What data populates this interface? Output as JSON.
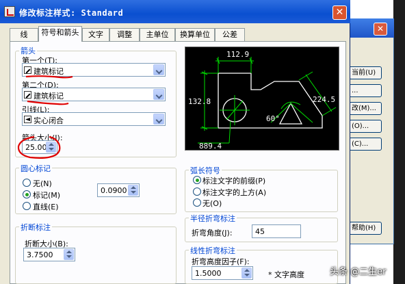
{
  "window": {
    "title": "修改标注样式: Standard",
    "close_glyph": "✕"
  },
  "tabs": [
    {
      "label": "线"
    },
    {
      "label": "符号和箭头"
    },
    {
      "label": "文字"
    },
    {
      "label": "调整"
    },
    {
      "label": "主单位"
    },
    {
      "label": "换算单位"
    },
    {
      "label": "公差"
    }
  ],
  "arrowheads": {
    "group_title": "箭头",
    "first_label": "第一个(T):",
    "first_value": "建筑标记",
    "second_label": "第二个(D):",
    "second_value": "建筑标记",
    "leader_label": "引线(L):",
    "leader_value": "实心闭合",
    "size_label": "箭头大小(I):",
    "size_value": "25.000("
  },
  "center_marks": {
    "group_title": "圆心标记",
    "options": [
      "无(N)",
      "标记(M)",
      "直线(E)"
    ],
    "selected": "标记(M)",
    "size_value": "0.0900"
  },
  "break": {
    "group_title": "折断标注",
    "size_label": "折断大小(B):",
    "size_value": "3.7500"
  },
  "arc_length": {
    "group_title": "弧长符号",
    "options": [
      "标注文字的前缀(P)",
      "标注文字的上方(A)",
      "无(O)"
    ],
    "selected": "标注文字的前缀(P)"
  },
  "radius_jog": {
    "group_title": "半径折弯标注",
    "angle_label": "折弯角度(J):",
    "angle_value": "45"
  },
  "linear_jog": {
    "group_title": "线性折弯标注",
    "factor_label": "折弯高度因子(F):",
    "factor_value": "1.5000",
    "suffix": "* 文字高度"
  },
  "preview": {
    "dims": [
      "112.9",
      "132.8",
      "224.5",
      "60°",
      "889.4"
    ],
    "colors": {
      "line": "#ffffff",
      "dimension": "#00e000",
      "text": "#ffffff",
      "background": "#000000"
    }
  },
  "background_dialog": {
    "close_glyph": "✕",
    "buttons": [
      "当前(U)",
      "...",
      "改(M)...",
      "(O)...",
      "(C)...",
      "帮助(H)"
    ]
  },
  "watermark": "头条 @二生er",
  "accent": {
    "annotation_red": "#e00000",
    "group_title_blue": "#0046d5"
  }
}
